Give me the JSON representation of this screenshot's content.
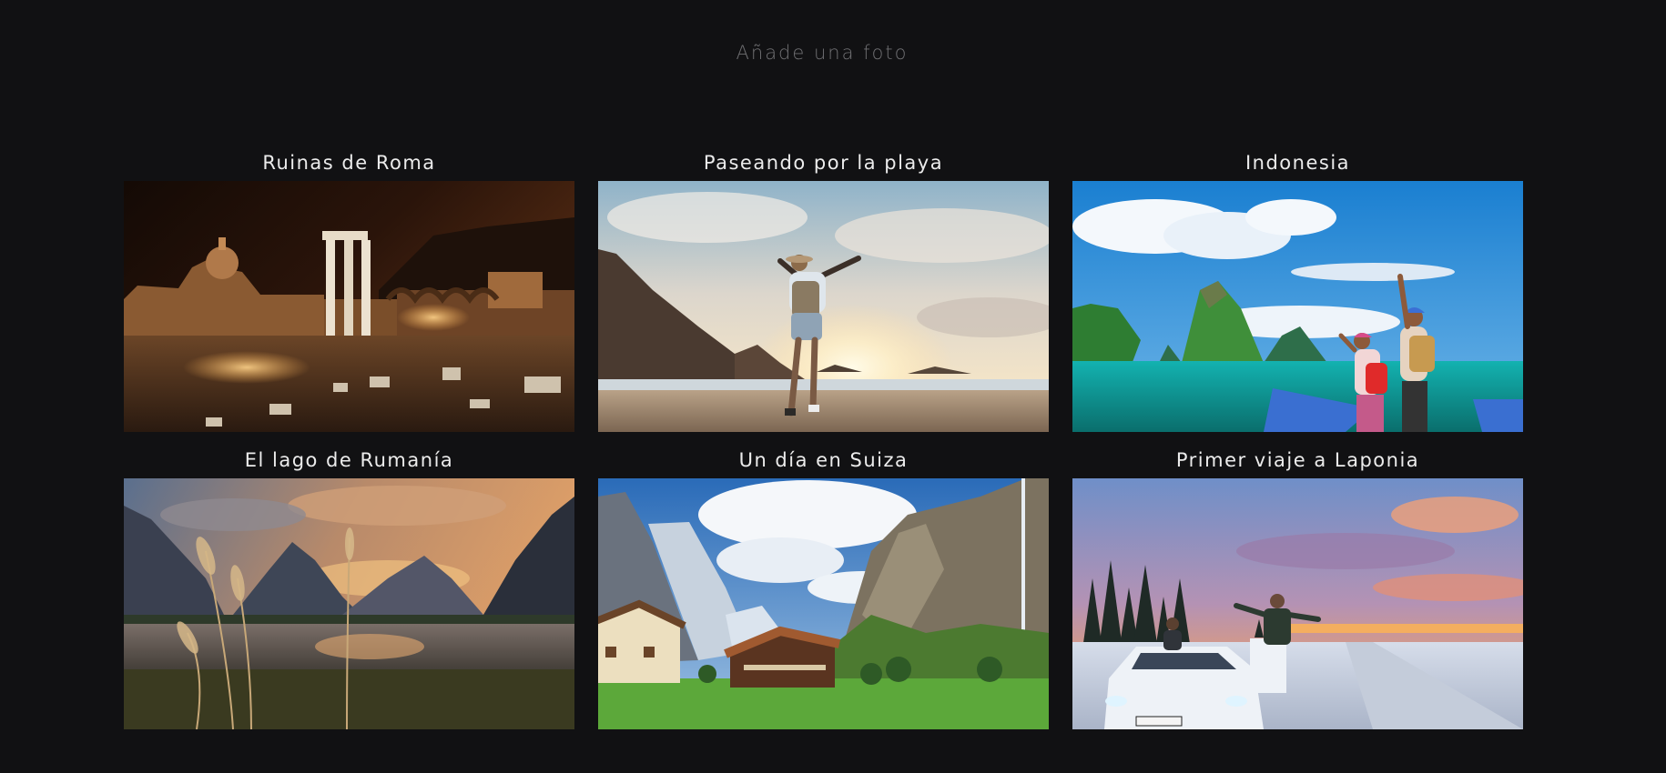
{
  "header": {
    "add_photo_label": "Añade una foto"
  },
  "gallery": {
    "items": [
      {
        "title": "Ruinas de Roma"
      },
      {
        "title": "Paseando por la playa"
      },
      {
        "title": "Indonesia"
      },
      {
        "title": "El lago de Rumanía"
      },
      {
        "title": "Un día en Suiza"
      },
      {
        "title": "Primer viaje a Laponia"
      }
    ]
  },
  "colors": {
    "background": "#111113",
    "title_text": "#ececec",
    "muted_text": "#6f6f72"
  }
}
